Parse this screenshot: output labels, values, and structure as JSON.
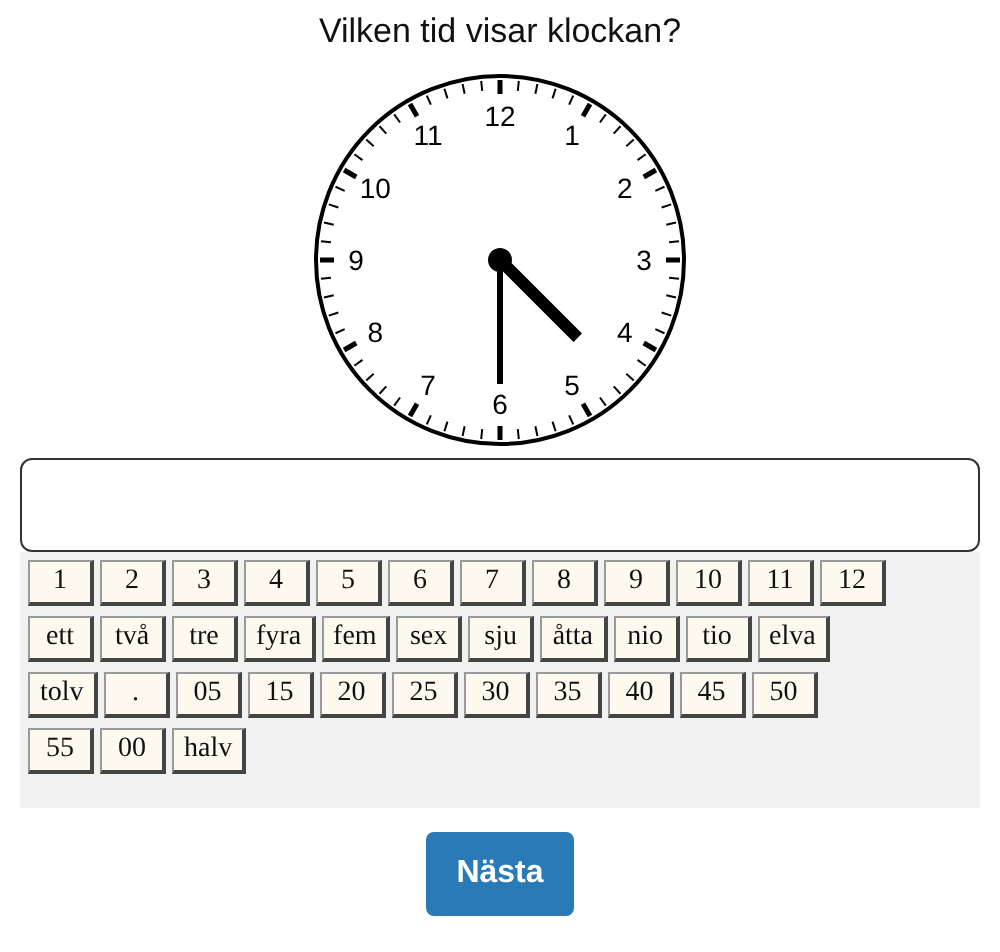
{
  "question": "Vilken tid visar klockan?",
  "clock": {
    "numerals": [
      "12",
      "1",
      "2",
      "3",
      "4",
      "5",
      "6",
      "7",
      "8",
      "9",
      "10",
      "11"
    ]
  },
  "keypad": {
    "rows": [
      [
        "1",
        "2",
        "3",
        "4",
        "5",
        "6",
        "7",
        "8",
        "9",
        "10",
        "11",
        "12"
      ],
      [
        "ett",
        "två",
        "tre",
        "fyra",
        "fem",
        "sex",
        "sju",
        "åtta",
        "nio",
        "tio",
        "elva"
      ],
      [
        "tolv",
        ".",
        "05",
        "15",
        "20",
        "25",
        "30",
        "35",
        "40",
        "45",
        "50"
      ],
      [
        "55",
        "00",
        "halv"
      ]
    ]
  },
  "next_button": "Nästa"
}
